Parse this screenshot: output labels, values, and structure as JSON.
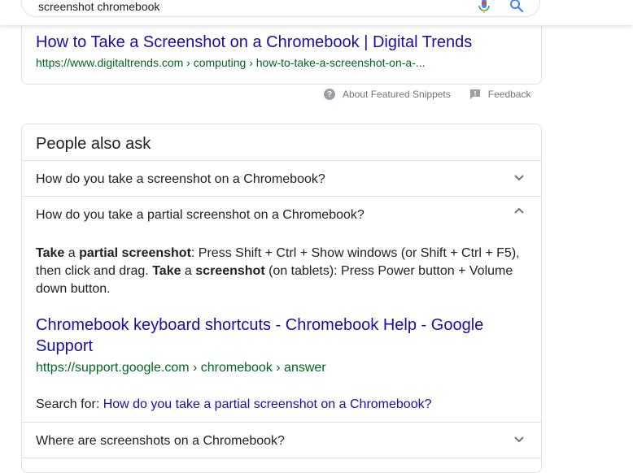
{
  "search": {
    "query": "screenshot chromebook"
  },
  "featured_snippet": {
    "title": "How to Take a Screenshot on a Chromebook | Digital Trends",
    "url": "https://www.digitaltrends.com › computing › how-to-take-a-screenshot-on-a-...",
    "about_label": "About Featured Snippets",
    "feedback_label": "Feedback"
  },
  "people_also_ask": {
    "heading": "People also ask",
    "questions": [
      {
        "text": "How do you take a screenshot on a Chromebook?",
        "expanded": false
      },
      {
        "text": "How do you take a partial screenshot on a Chromebook?",
        "expanded": true
      },
      {
        "text": "Where are screenshots on a Chromebook?",
        "expanded": false
      }
    ],
    "answer": {
      "p1_bold1": "Take",
      "p1_t1": " a ",
      "p1_bold2": "partial screenshot",
      "p1_t2": ": Press Shift + Ctrl + Show windows (or Shift + Ctrl + F5), then click and drag. ",
      "p1_bold3": "Take",
      "p1_t3": " a ",
      "p1_bold4": "screenshot",
      "p1_t4": " (on tablets): Press Power button + Volume down button.",
      "link_title": "Chromebook keyboard shortcuts - Chromebook Help - Google Support",
      "link_url": "https://support.google.com › chromebook › answer",
      "search_for_label": "Search for: ",
      "search_for_link": "How do you take a partial screenshot on a Chromebook?"
    }
  },
  "colors": {
    "link": "#1a0dab",
    "url_green": "#006621",
    "border": "#dfe1e5",
    "search_blue": "#4285f4"
  }
}
